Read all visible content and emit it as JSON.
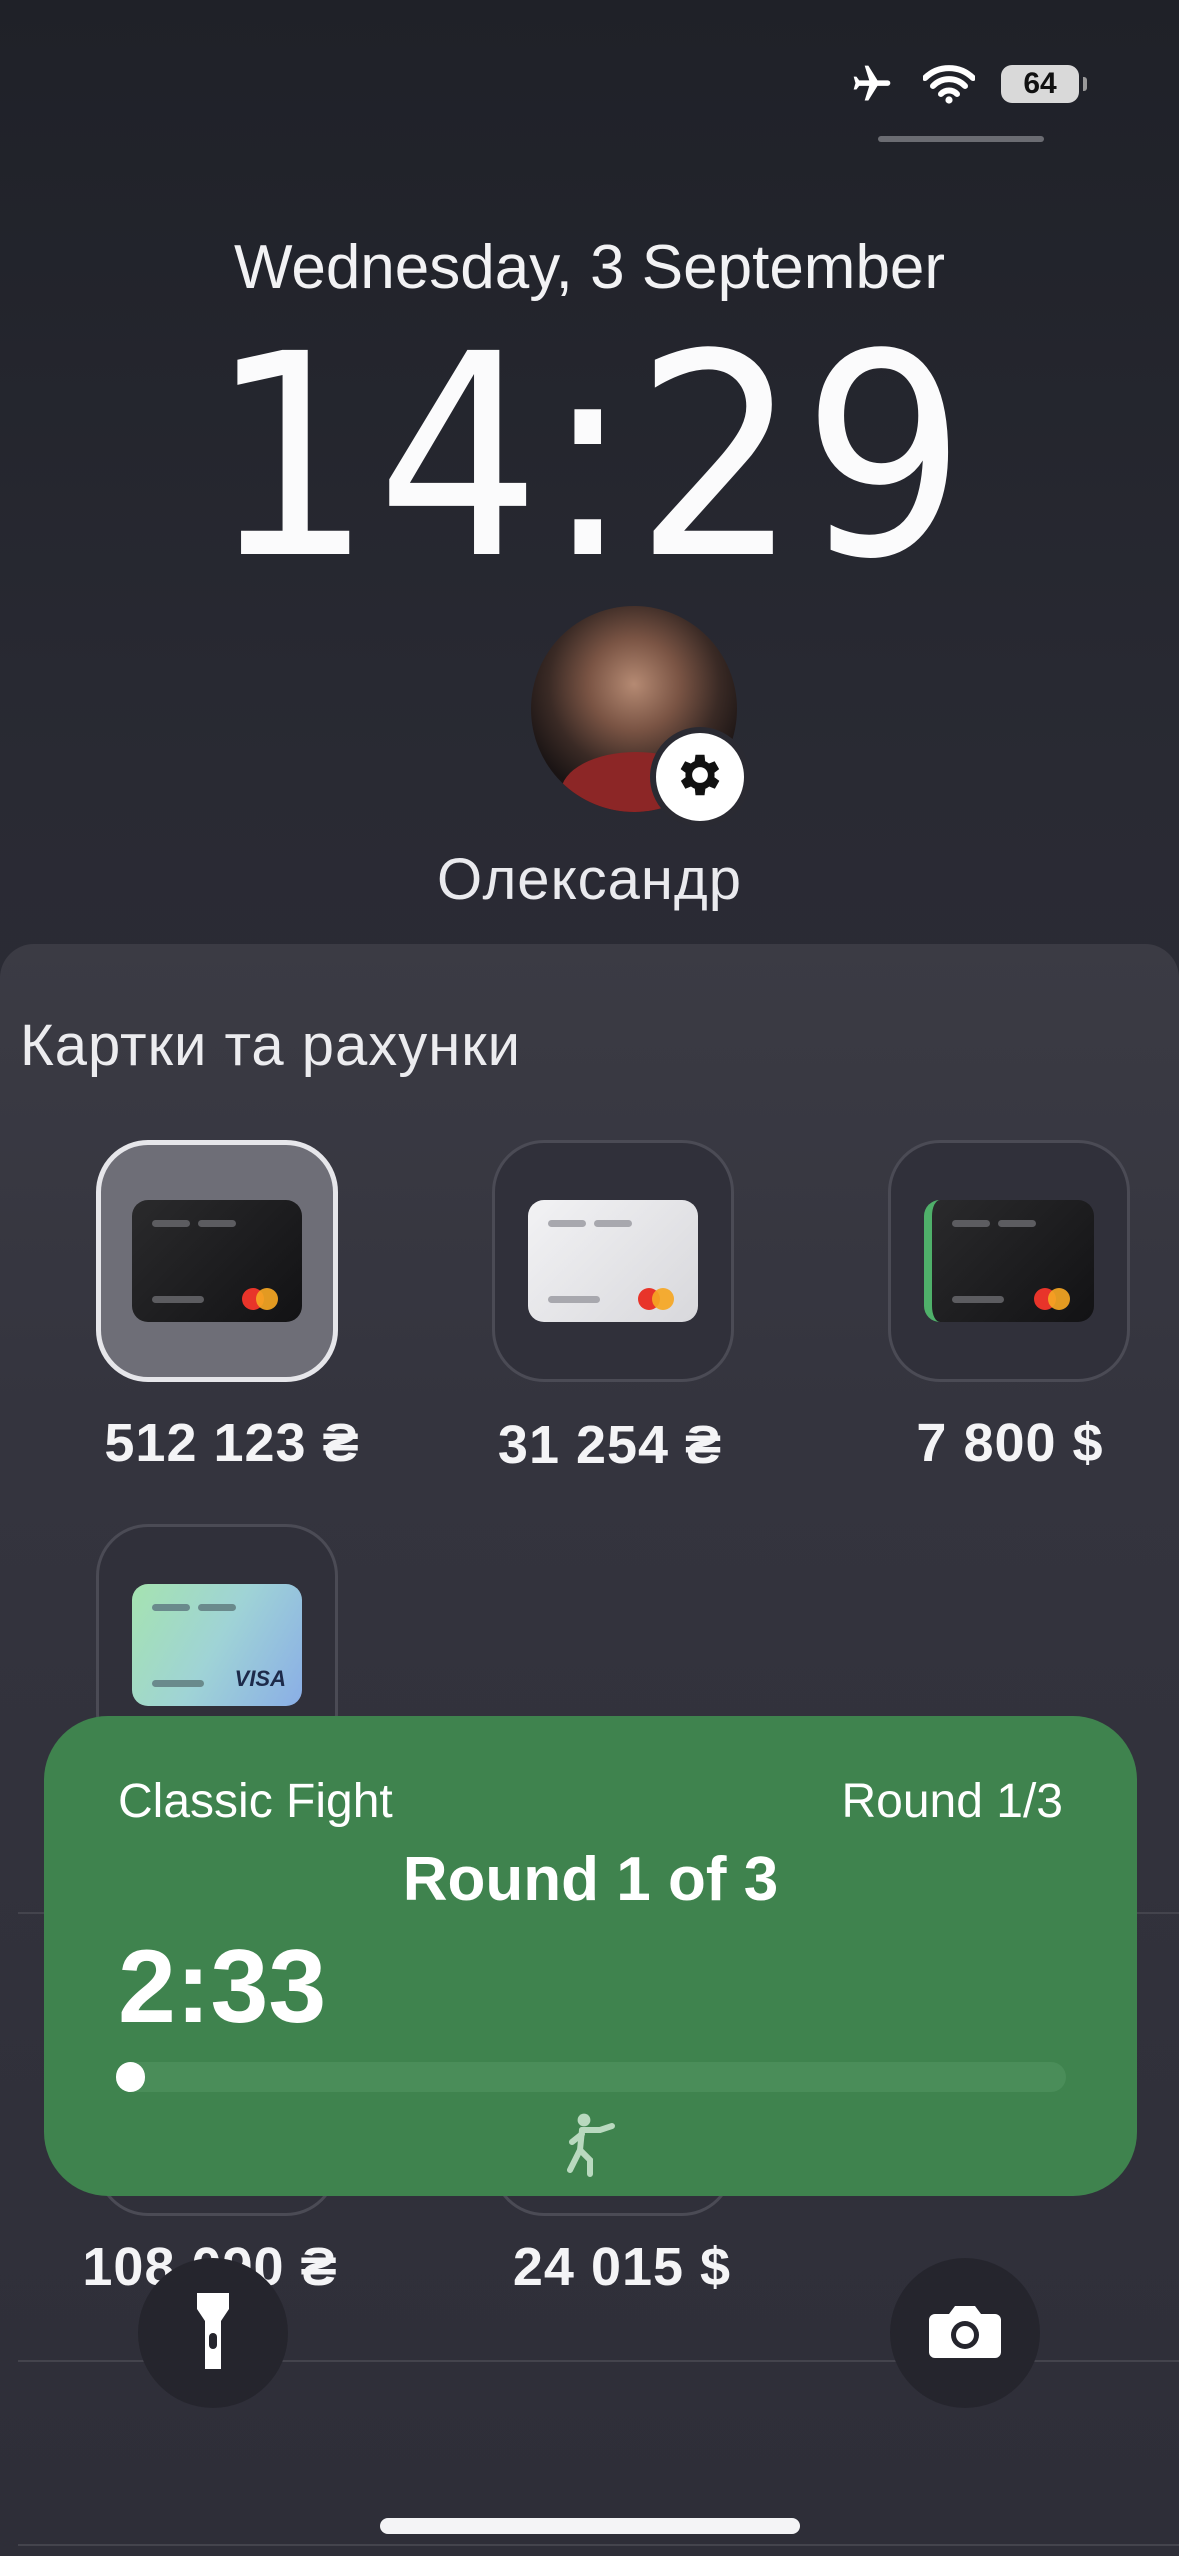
{
  "status_bar": {
    "battery": "64",
    "icons": [
      "airplane-icon",
      "wifi-icon",
      "battery-icon"
    ]
  },
  "lock_screen": {
    "date": "Wednesday, 3 September",
    "time": "14:29",
    "user_name": "Олександр"
  },
  "cards_section": {
    "title": "Картки та рахунки",
    "cards": [
      {
        "type": "black-mastercard",
        "amount": "512 123 ₴",
        "selected": true
      },
      {
        "type": "white-mastercard",
        "amount": "31 254 ₴",
        "selected": false
      },
      {
        "type": "black-green-mastercard",
        "amount": "7 800 $",
        "selected": false
      },
      {
        "type": "visa-gradient",
        "amount": "",
        "selected": false
      },
      {
        "type": "hidden",
        "amount": "108 090 ₴",
        "selected": false
      },
      {
        "type": "hidden",
        "amount": "24 015 $",
        "selected": false
      }
    ],
    "visa_label": "VISA"
  },
  "live_activity": {
    "mode": "Classic Fight",
    "round_short": "Round 1/3",
    "round_long": "Round 1 of 3",
    "timer": "2:33",
    "progress": 0.03,
    "icon": "boxer-icon"
  },
  "quick_actions": {
    "left": "flashlight-icon",
    "right": "camera-icon"
  },
  "colors": {
    "live_activity_bg": "#3f834e",
    "background": "#2a2a33"
  }
}
